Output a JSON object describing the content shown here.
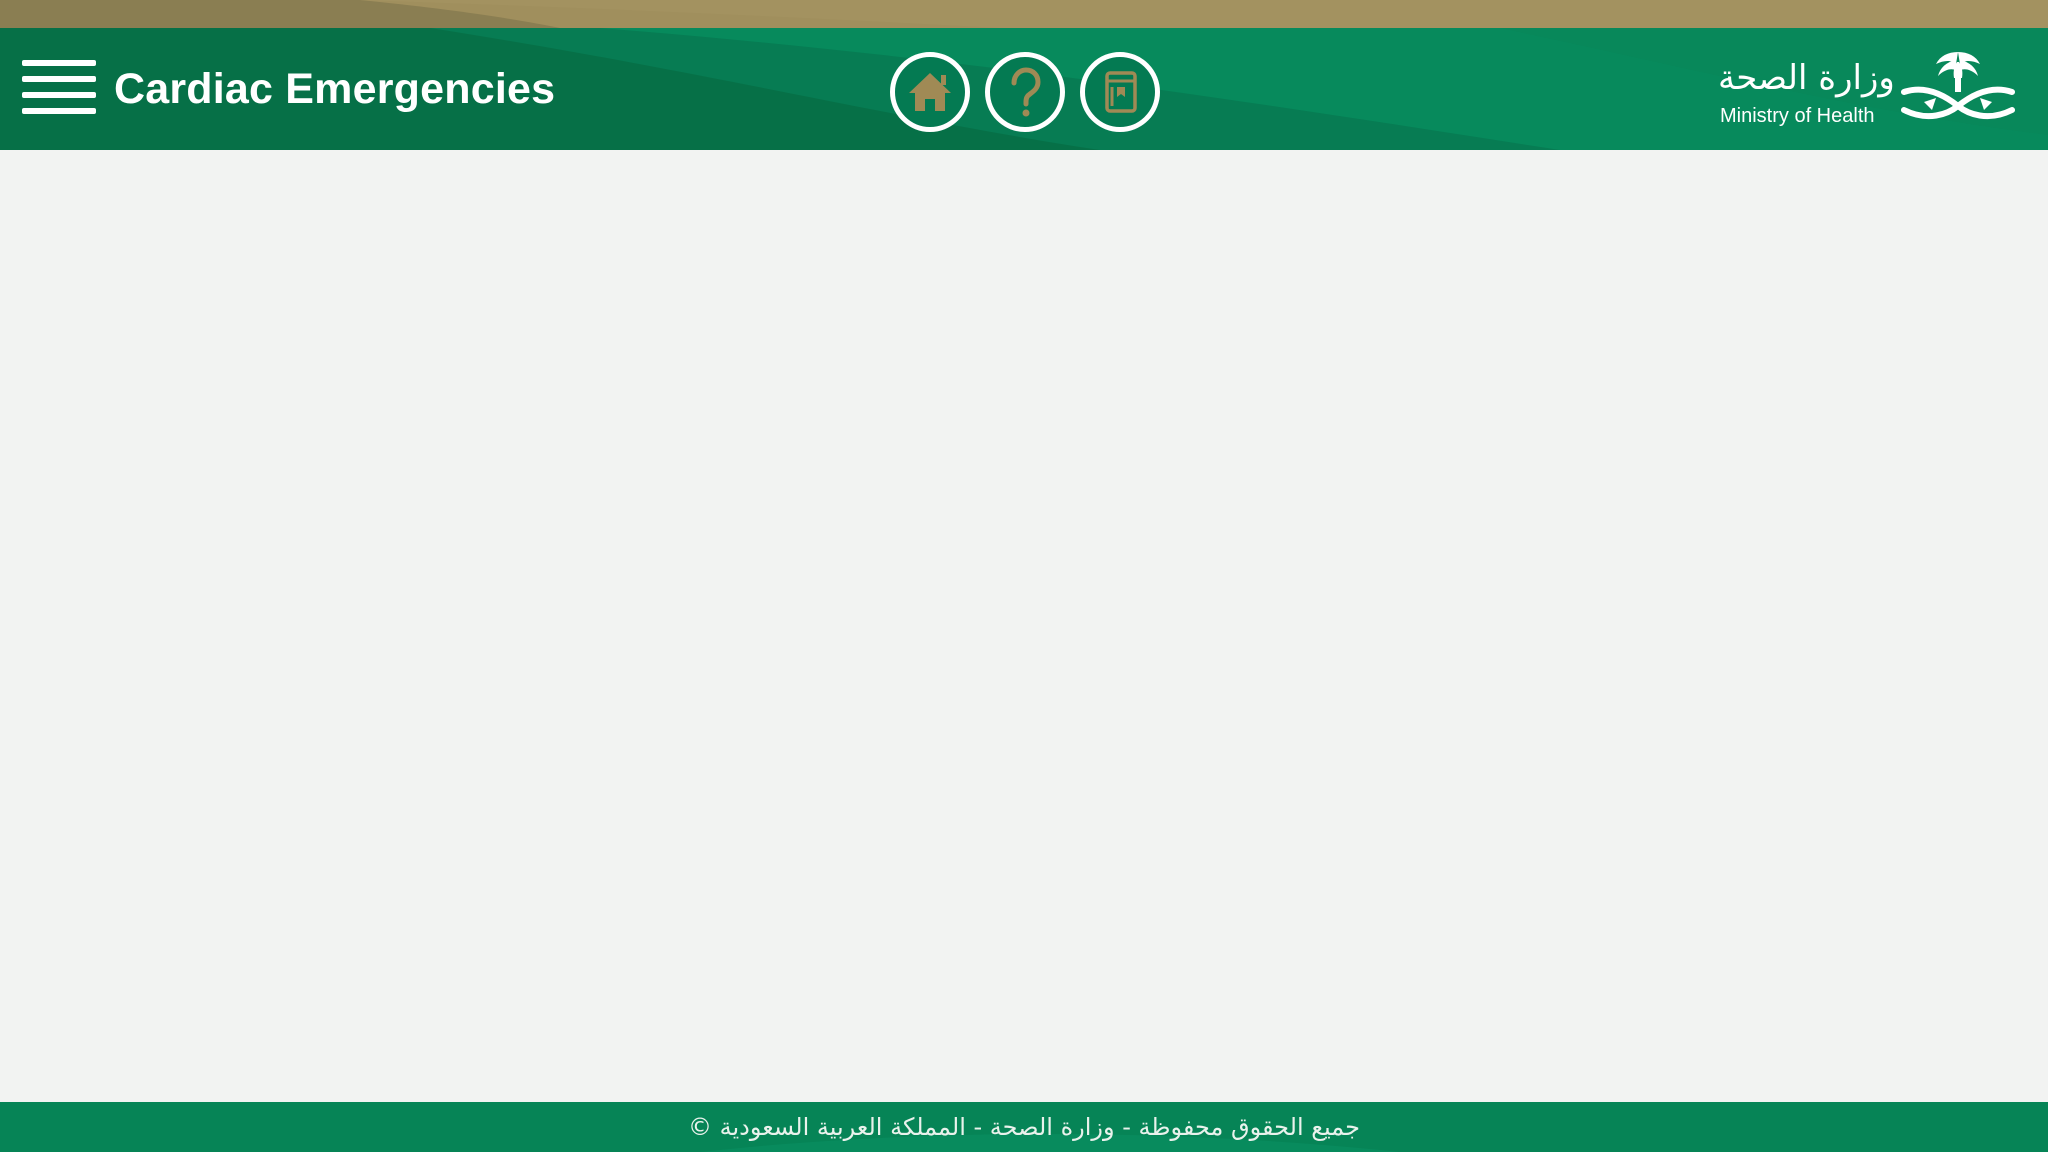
{
  "header": {
    "title": "Cardiac Emergencies",
    "menu_icon": "hamburger-menu-icon",
    "actions": [
      {
        "name": "home",
        "icon": "home-icon"
      },
      {
        "name": "help",
        "icon": "question-mark-icon"
      },
      {
        "name": "guide",
        "icon": "book-icon"
      }
    ]
  },
  "branding": {
    "name_ar": "وزارة الصحة",
    "name_en": "Ministry of Health",
    "emblem_icon": "palm-swords-emblem-icon"
  },
  "footer": {
    "text": "جميع الحقوق محفوظة - وزارة الصحة - المملكة العربية السعودية ©"
  },
  "colors": {
    "header_green": "#047a52",
    "header_dark_green": "#066e48",
    "gold_band": "#a08f5d",
    "icon_gold": "#a08a55",
    "content_background": "#f2f3f2",
    "footer_green": "#068456"
  }
}
